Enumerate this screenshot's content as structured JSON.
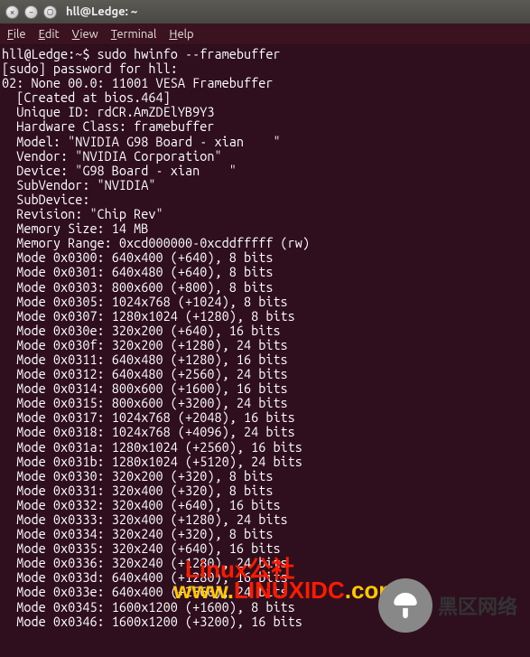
{
  "window": {
    "title": "hll@Ledge: ~"
  },
  "menu": {
    "file": "File",
    "edit": "Edit",
    "view": "View",
    "terminal": "Terminal",
    "help": "Help"
  },
  "terminal": {
    "prompt": "hll@Ledge:~$ ",
    "command": "sudo hwinfo --framebuffer",
    "sudo_line": "[sudo] password for hll:",
    "header": "02: None 00.0: 11001 VESA Framebuffer",
    "info": [
      "[Created at bios.464]",
      "Unique ID: rdCR.AmZDElYB9Y3",
      "Hardware Class: framebuffer",
      "Model: \"NVIDIA G98 Board - xian    \"",
      "Vendor: \"NVIDIA Corporation\"",
      "Device: \"G98 Board - xian    \"",
      "SubVendor: \"NVIDIA\"",
      "SubDevice: ",
      "Revision: \"Chip Rev\"",
      "Memory Size: 14 MB",
      "Memory Range: 0xcd000000-0xcddfffff (rw)"
    ],
    "modes": [
      "Mode 0x0300: 640x400 (+640), 8 bits",
      "Mode 0x0301: 640x480 (+640), 8 bits",
      "Mode 0x0303: 800x600 (+800), 8 bits",
      "Mode 0x0305: 1024x768 (+1024), 8 bits",
      "Mode 0x0307: 1280x1024 (+1280), 8 bits",
      "Mode 0x030e: 320x200 (+640), 16 bits",
      "Mode 0x030f: 320x200 (+1280), 24 bits",
      "Mode 0x0311: 640x480 (+1280), 16 bits",
      "Mode 0x0312: 640x480 (+2560), 24 bits",
      "Mode 0x0314: 800x600 (+1600), 16 bits",
      "Mode 0x0315: 800x600 (+3200), 24 bits",
      "Mode 0x0317: 1024x768 (+2048), 16 bits",
      "Mode 0x0318: 1024x768 (+4096), 24 bits",
      "Mode 0x031a: 1280x1024 (+2560), 16 bits",
      "Mode 0x031b: 1280x1024 (+5120), 24 bits",
      "Mode 0x0330: 320x200 (+320), 8 bits",
      "Mode 0x0331: 320x400 (+320), 8 bits",
      "Mode 0x0332: 320x400 (+640), 16 bits",
      "Mode 0x0333: 320x400 (+1280), 24 bits",
      "Mode 0x0334: 320x240 (+320), 8 bits",
      "Mode 0x0335: 320x240 (+640), 16 bits",
      "Mode 0x0336: 320x240 (+1280), 24 bits",
      "Mode 0x033d: 640x400 (+1280), 16 bits",
      "Mode 0x033e: 640x400 (+2560), 24 bits",
      "Mode 0x0345: 1600x1200 (+1600), 8 bits",
      "Mode 0x0346: 1600x1200 (+3200), 16 bits"
    ]
  },
  "watermarks": {
    "linux_gs": "Linux公社",
    "linuxidc": "www.linuxidc.com",
    "heiqu": "黑区网络"
  }
}
